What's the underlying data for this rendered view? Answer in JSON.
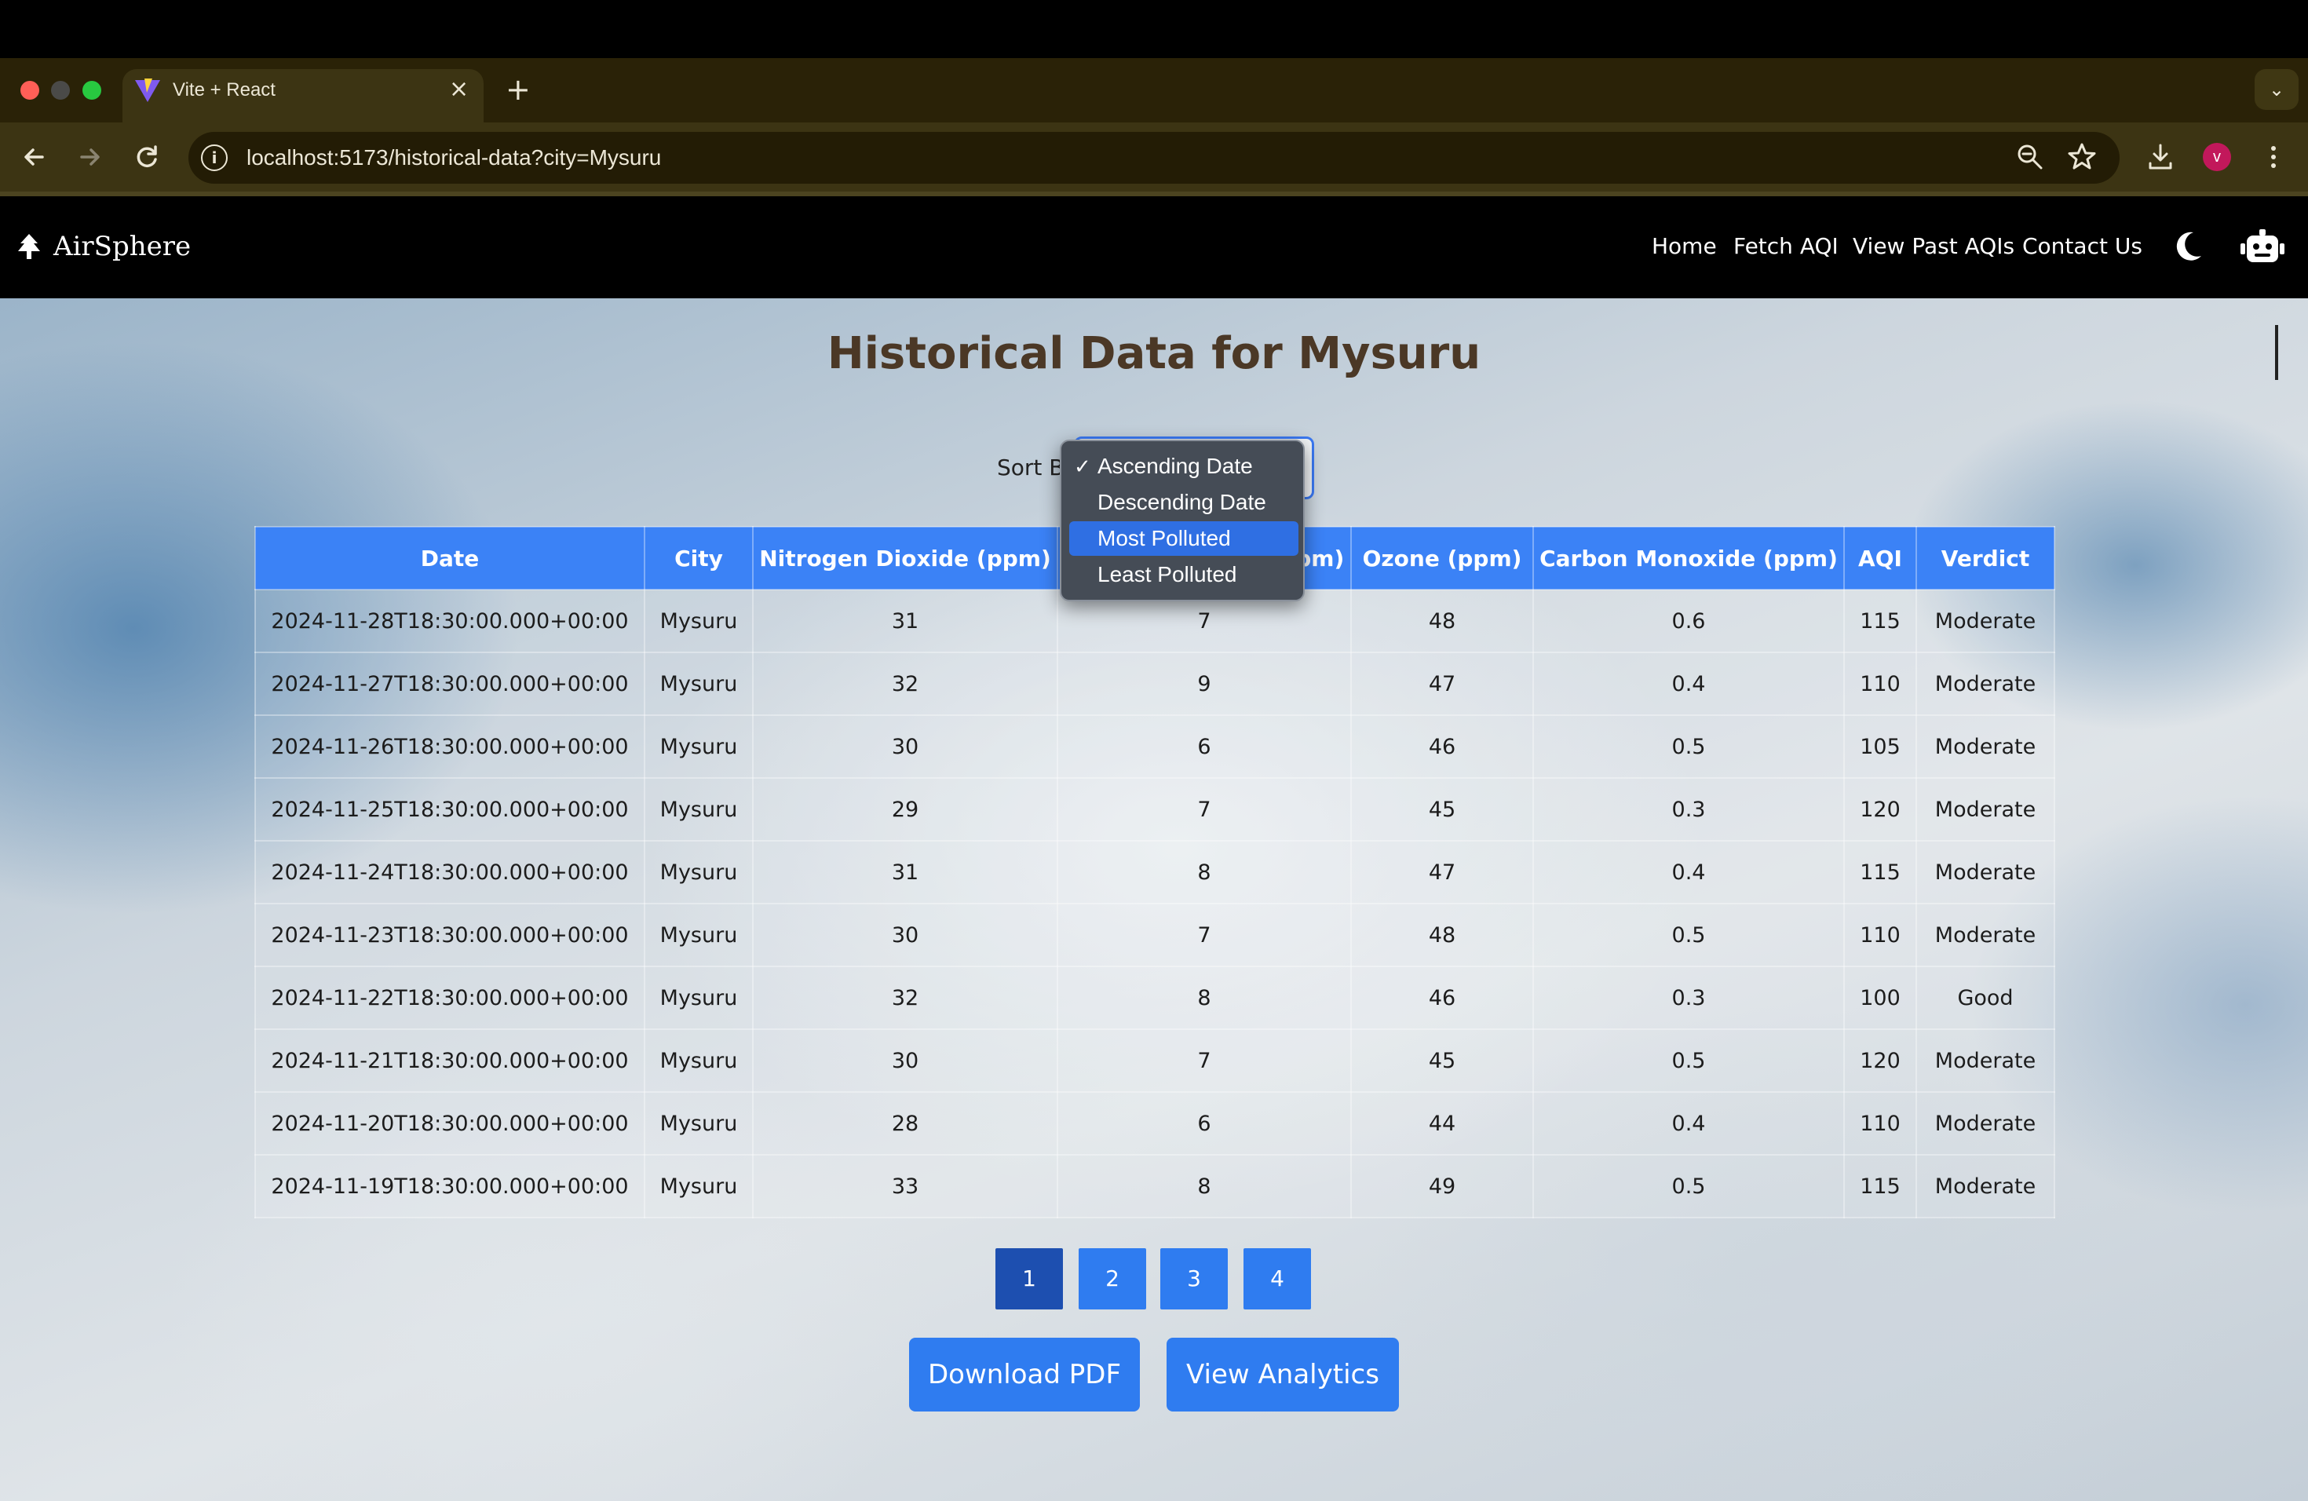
{
  "browser": {
    "tab_title": "Vite + React",
    "tab_close": "×",
    "new_tab": "+",
    "tab_menu": "⌄",
    "url": "localhost:5173/historical-data?city=Mysuru",
    "profile_initial": "v",
    "icons": [
      "back-icon",
      "forward-icon",
      "reload-icon",
      "site-info-icon",
      "zoom-icon",
      "bookmark-star-icon",
      "download-icon",
      "more-icon"
    ]
  },
  "navbar": {
    "brand": "AirSphere",
    "links": [
      "Home",
      "Fetch AQI",
      "View Past AQIs",
      "Contact Us"
    ]
  },
  "page": {
    "title": "Historical Data for Mysuru",
    "sort_label": "Sort By:"
  },
  "sort_dropdown": {
    "options": [
      "Ascending Date",
      "Descending Date",
      "Most Polluted",
      "Least Polluted"
    ],
    "checked": "Ascending Date",
    "highlighted": "Most Polluted",
    "check_mark": "✓"
  },
  "table": {
    "headers": [
      "Date",
      "City",
      "Nitrogen Dioxide (ppm)",
      "Sulphur Dioxide (ppm)",
      "Ozone (ppm)",
      "Carbon Monoxide (ppm)",
      "AQI",
      "Verdict"
    ],
    "rows": [
      [
        "2024-11-28T18:30:00.000+00:00",
        "Mysuru",
        "31",
        "7",
        "48",
        "0.6",
        "115",
        "Moderate"
      ],
      [
        "2024-11-27T18:30:00.000+00:00",
        "Mysuru",
        "32",
        "9",
        "47",
        "0.4",
        "110",
        "Moderate"
      ],
      [
        "2024-11-26T18:30:00.000+00:00",
        "Mysuru",
        "30",
        "6",
        "46",
        "0.5",
        "105",
        "Moderate"
      ],
      [
        "2024-11-25T18:30:00.000+00:00",
        "Mysuru",
        "29",
        "7",
        "45",
        "0.3",
        "120",
        "Moderate"
      ],
      [
        "2024-11-24T18:30:00.000+00:00",
        "Mysuru",
        "31",
        "8",
        "47",
        "0.4",
        "115",
        "Moderate"
      ],
      [
        "2024-11-23T18:30:00.000+00:00",
        "Mysuru",
        "30",
        "7",
        "48",
        "0.5",
        "110",
        "Moderate"
      ],
      [
        "2024-11-22T18:30:00.000+00:00",
        "Mysuru",
        "32",
        "8",
        "46",
        "0.3",
        "100",
        "Good"
      ],
      [
        "2024-11-21T18:30:00.000+00:00",
        "Mysuru",
        "30",
        "7",
        "45",
        "0.5",
        "120",
        "Moderate"
      ],
      [
        "2024-11-20T18:30:00.000+00:00",
        "Mysuru",
        "28",
        "6",
        "44",
        "0.4",
        "110",
        "Moderate"
      ],
      [
        "2024-11-19T18:30:00.000+00:00",
        "Mysuru",
        "33",
        "8",
        "49",
        "0.5",
        "115",
        "Moderate"
      ]
    ]
  },
  "pagination": {
    "pages": [
      "1",
      "2",
      "3",
      "4"
    ],
    "active": "1"
  },
  "actions": {
    "download_pdf": "Download PDF",
    "view_analytics": "View Analytics"
  },
  "colors": {
    "accent": "#3b82f6",
    "active_page": "#1d4fb0",
    "title": "#4b3826",
    "chrome_bg": "#2a2207"
  }
}
